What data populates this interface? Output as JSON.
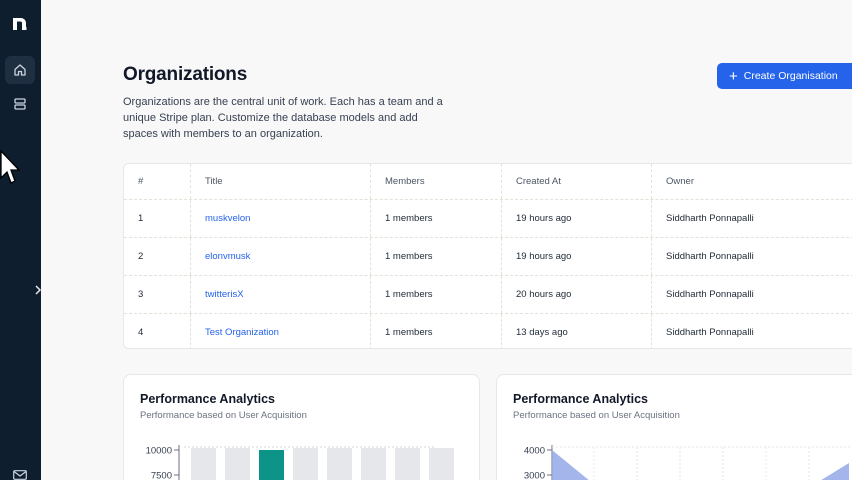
{
  "sidebar": {
    "logo": "brand-logo",
    "items": [
      {
        "icon": "home-icon",
        "active": true
      },
      {
        "icon": "database-icon",
        "active": false
      }
    ],
    "collapse_icon": "chevron-right-icon",
    "bottom_icon": "mail-icon"
  },
  "header": {
    "title": "Organizations",
    "description": "Organizations are the central unit of work. Each has a team and a unique Stripe plan. Customize the database models and add spaces with members to an organization.",
    "create_button": "Create Organisation",
    "accent": "#2563eb"
  },
  "table": {
    "columns": [
      "#",
      "Title",
      "Members",
      "Created At",
      "Owner"
    ],
    "rows": [
      {
        "num": "1",
        "title": "muskvelon",
        "members": "1 members",
        "created": "19 hours ago",
        "owner": "Siddharth Ponnapalli"
      },
      {
        "num": "2",
        "title": "elonvmusk",
        "members": "1 members",
        "created": "19 hours ago",
        "owner": "Siddharth Ponnapalli"
      },
      {
        "num": "3",
        "title": "twitterisX",
        "members": "1 members",
        "created": "20 hours ago",
        "owner": "Siddharth Ponnapalli"
      },
      {
        "num": "4",
        "title": "Test Organization",
        "members": "1 members",
        "created": "13 days ago",
        "owner": "Siddharth Ponnapalli"
      }
    ]
  },
  "cards": [
    {
      "title": "Performance Analytics",
      "subtitle": "Performance based on User Acquisition"
    },
    {
      "title": "Performance Analytics",
      "subtitle": "Performance based on User Acquisition"
    }
  ],
  "chart_data": [
    {
      "type": "bar",
      "title": "Performance Analytics",
      "subtitle": "Performance based on User Acquisition",
      "yticks": [
        "10000",
        "7500"
      ],
      "ylim": [
        0,
        10000
      ],
      "bars_visible": 8,
      "highlight_index": 2,
      "highlight_value": 10000,
      "bar_color": "#e5e7eb",
      "highlight_color": "#0d9488"
    },
    {
      "type": "area",
      "title": "Performance Analytics",
      "subtitle": "Performance based on User Acquisition",
      "yticks": [
        "4000",
        "3000"
      ],
      "ylim": [
        0,
        4000
      ],
      "fill_color": "#93a8e6"
    }
  ]
}
